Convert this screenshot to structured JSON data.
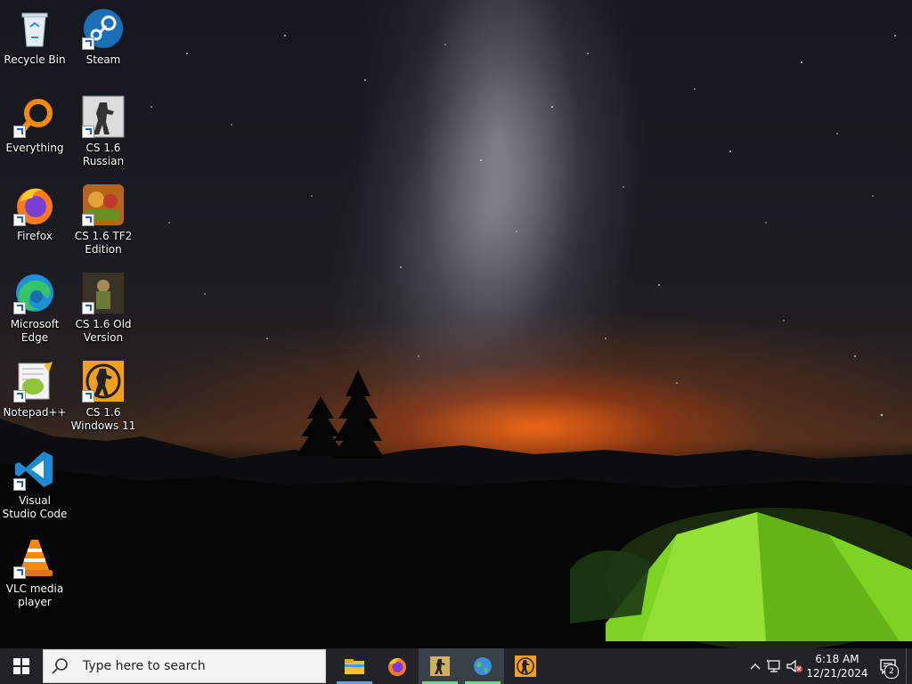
{
  "desktop": {
    "icons": [
      {
        "label": "Recycle Bin",
        "icon": "recycle-bin-icon"
      },
      {
        "label": "Steam",
        "icon": "steam-icon"
      },
      {
        "label": "Everything",
        "icon": "everything-search-icon"
      },
      {
        "label": "CS 1.6 Russian",
        "icon": "counter-strike-icon"
      },
      {
        "label": "Firefox",
        "icon": "firefox-icon"
      },
      {
        "label": "CS 1.6 TF2 Edition",
        "icon": "counter-strike-tf2-icon"
      },
      {
        "label": "Microsoft Edge",
        "icon": "edge-icon"
      },
      {
        "label": "CS 1.6 Old Version",
        "icon": "counter-strike-old-icon"
      },
      {
        "label": "Notepad++",
        "icon": "notepad-plus-plus-icon"
      },
      {
        "label": "CS 1.6 Windows 11",
        "icon": "counter-strike-win11-icon"
      },
      {
        "label": "Visual Studio Code",
        "icon": "vscode-icon"
      },
      {
        "label": "VLC media player",
        "icon": "vlc-icon"
      }
    ]
  },
  "taskbar": {
    "search_placeholder": "Type here to search",
    "apps": [
      {
        "name": "File Explorer",
        "icon": "file-explorer-icon"
      },
      {
        "name": "Firefox",
        "icon": "firefox-icon"
      },
      {
        "name": "CS 1.6",
        "icon": "counter-strike-icon"
      },
      {
        "name": "Browser",
        "icon": "globe-icon"
      },
      {
        "name": "Counter-Strike",
        "icon": "counter-strike-logo-icon"
      }
    ],
    "clock": {
      "time": "6:18 AM",
      "date": "12/21/2024"
    },
    "notification_count": "2"
  },
  "colors": {
    "taskbar_bg": "#202428",
    "accent": "#6aa0d8",
    "tent_green": "#7dd321"
  }
}
